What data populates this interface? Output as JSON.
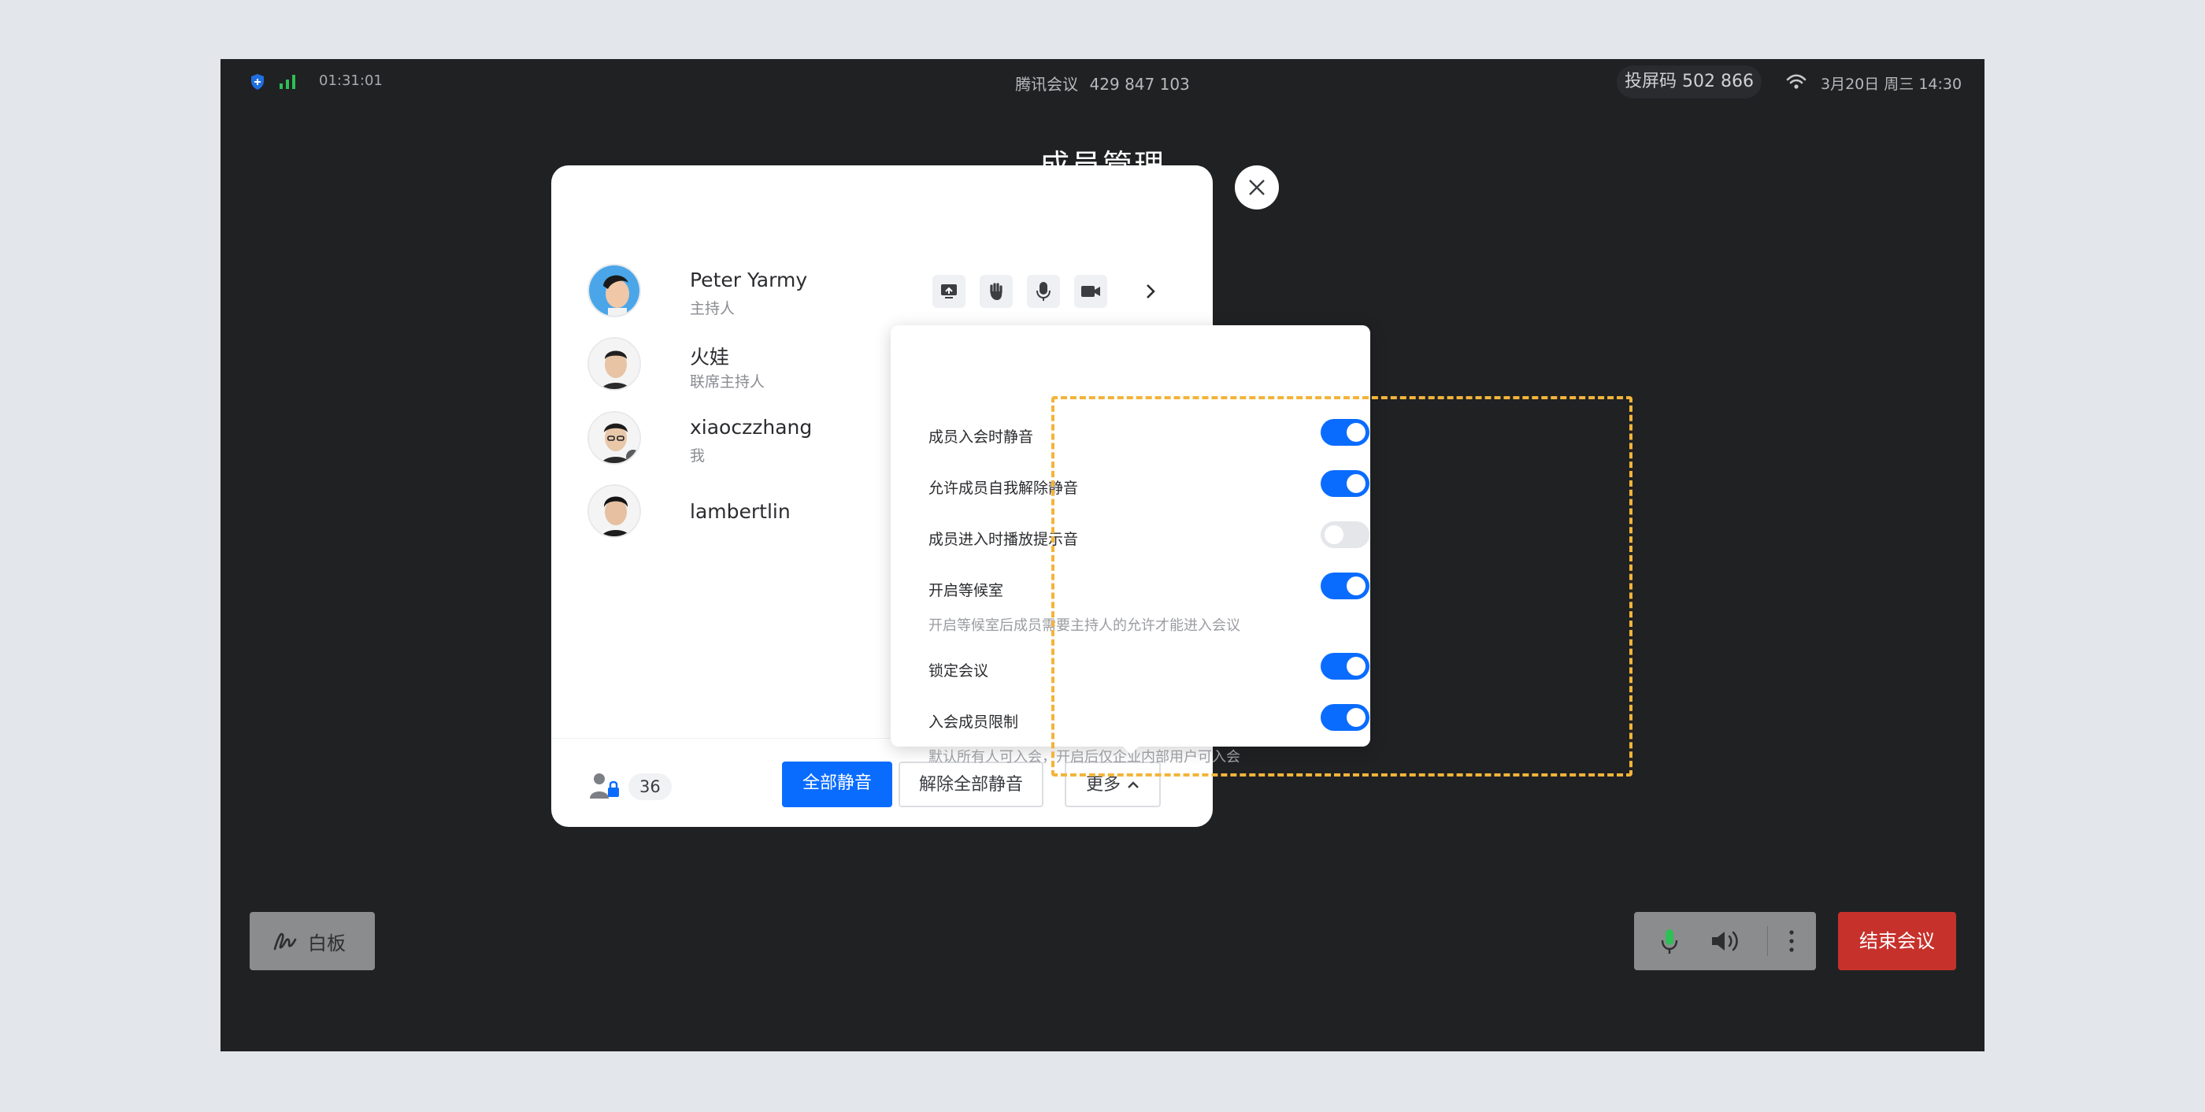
{
  "status_bar": {
    "elapsed_time": "01:31:01",
    "app_name": "腾讯会议",
    "meeting_id": "429 847 103",
    "cast_code": "投屏码 502 866",
    "datetime": "3月20日 周三 14:30"
  },
  "page_title": "成员管理",
  "members": [
    {
      "name": "Peter Yarmy",
      "role": "主持人"
    },
    {
      "name": "火娃",
      "role": "联席主持人"
    },
    {
      "name": "xiaoczzhang",
      "role": "我"
    },
    {
      "name": "lambertlin",
      "role": ""
    }
  ],
  "footer": {
    "member_count": "36",
    "mute_all_label": "全部静音",
    "unmute_all_label": "解除全部静音",
    "more_label": "更多"
  },
  "settings": [
    {
      "label": "成员入会时静音",
      "enabled": true,
      "desc": ""
    },
    {
      "label": "允许成员自我解除静音",
      "enabled": true,
      "desc": ""
    },
    {
      "label": "成员进入时播放提示音",
      "enabled": false,
      "desc": ""
    },
    {
      "label": "开启等候室",
      "enabled": true,
      "desc": "开启等候室后成员需要主持人的允许才能进入会议"
    },
    {
      "label": "锁定会议",
      "enabled": true,
      "desc": ""
    },
    {
      "label": "入会成员限制",
      "enabled": true,
      "desc": "默认所有人可入会，开启后仅企业内部用户可入会"
    }
  ],
  "bottom_bar": {
    "whiteboard_label": "白板",
    "end_meeting_label": "结束会议"
  },
  "colors": {
    "accent": "#0a6cff",
    "end_button": "#c7312b",
    "highlight_frame": "#f2b43a",
    "screen_bg": "#202123"
  }
}
